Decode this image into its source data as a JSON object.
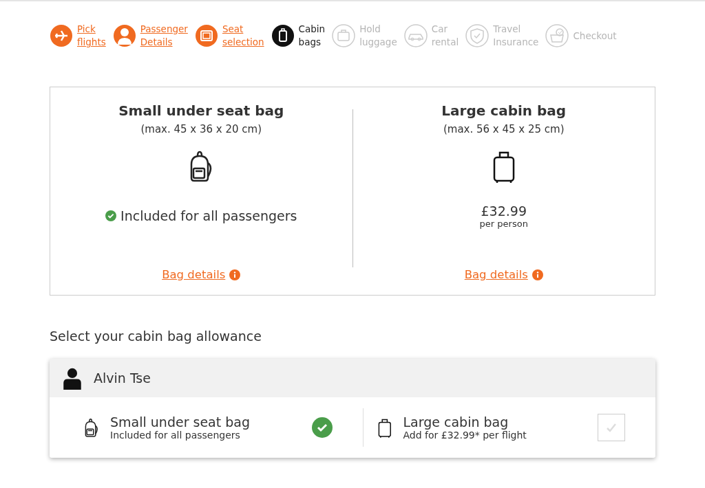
{
  "steps": [
    {
      "label": [
        "Pick",
        "flights"
      ],
      "completed": true,
      "selected": false
    },
    {
      "label": [
        "Passenger",
        "Details"
      ],
      "completed": true,
      "selected": false
    },
    {
      "label": [
        "Seat",
        "selection"
      ],
      "completed": true,
      "selected": false
    },
    {
      "label": [
        "Cabin",
        "bags"
      ],
      "completed": false,
      "selected": true
    },
    {
      "label": [
        "Hold",
        "luggage"
      ],
      "completed": false,
      "selected": false
    },
    {
      "label": [
        "Car",
        "rental"
      ],
      "completed": false,
      "selected": false
    },
    {
      "label": [
        "Travel",
        "Insurance"
      ],
      "completed": false,
      "selected": false
    },
    {
      "label": [
        "Checkout"
      ],
      "completed": false,
      "selected": false
    }
  ],
  "bags": [
    {
      "kind": "included",
      "title": "Small under seat bag",
      "size": "(max. 45 x 36 x 20 cm)",
      "note": "Included for all passengers",
      "link": "Bag details"
    },
    {
      "kind": "priced",
      "title": "Large cabin bag",
      "size": "(max. 56 x 45 x 25 cm)",
      "price": "£32.99",
      "per": "per person",
      "link": "Bag details"
    }
  ],
  "allowance_heading": "Select your cabin bag allowance",
  "passengers": [
    {
      "name": "Alvin Tse",
      "options": [
        {
          "kind": "included",
          "title": "Small under seat bag",
          "subtitle": "Included for all passengers",
          "checked": true
        },
        {
          "kind": "optional",
          "title": "Large cabin bag",
          "subtitle": "Add for £32.99* per flight",
          "checked": false
        }
      ]
    }
  ]
}
